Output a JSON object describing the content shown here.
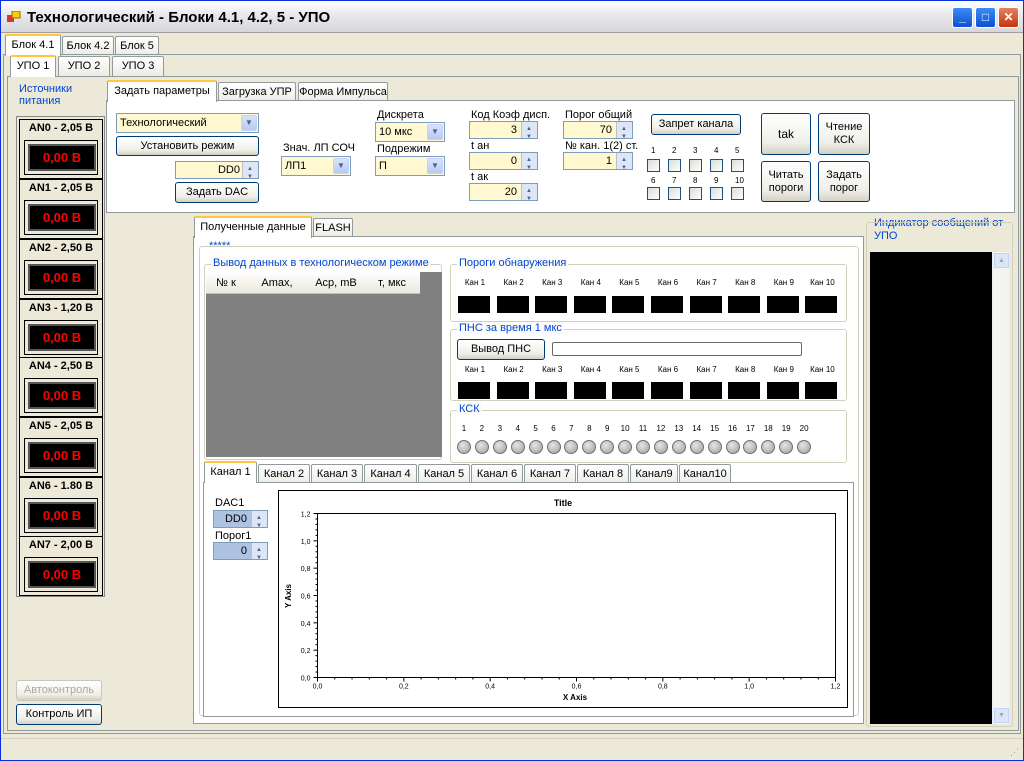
{
  "window": {
    "title": "Технологический - Блоки 4.1, 4.2, 5 - УПО"
  },
  "top_tabs": [
    "Блок 4.1",
    "Блок 4.2",
    "Блок 5"
  ],
  "upo_tabs": [
    "УПО 1",
    "УПО 2",
    "УПО 3"
  ],
  "left": {
    "title": "Источники питания",
    "sources": [
      {
        "name": "AN0 - 2,05 В",
        "value": "0,00 В"
      },
      {
        "name": "AN1 - 2,05 В",
        "value": "0,00 В"
      },
      {
        "name": "AN2 - 2,50 В",
        "value": "0,00 В"
      },
      {
        "name": "AN3 - 1,20 В",
        "value": "0,00 В"
      },
      {
        "name": "AN4 - 2,50 В",
        "value": "0,00 В"
      },
      {
        "name": "AN5 - 2,05 В",
        "value": "0,00 В"
      },
      {
        "name": "AN6 - 1.80 В",
        "value": "0,00 В"
      },
      {
        "name": "AN7 - 2,00 В",
        "value": "0,00 В"
      }
    ],
    "autocontrol": "Автоконтроль",
    "control_ip": "Контроль ИП"
  },
  "param_tabs": [
    "Задать параметры",
    "Загрузка УПР",
    "Форма Импульса"
  ],
  "params": {
    "mode": "Технологический",
    "set_mode": "Установить режим",
    "dd0": "DD0",
    "set_dac": "Задать DAC",
    "lp_label": "Знач. ЛП СОЧ",
    "lp_value": "ЛП1",
    "discrete_label": "Дискрета",
    "discrete_value": "10 мкс",
    "submode_label": "Подрежим",
    "submode_value": "П",
    "code_label": "Код Коэф дисп.",
    "code_value": "3",
    "tan_label": "t ан",
    "tan_value": "0",
    "tak_label": "t ак",
    "tak_value": "20",
    "porog_label": "Порог общий",
    "porog_value": "70",
    "kan_label": "№ кан. 1(2) ст.",
    "kan_value": "1",
    "ban": "Запрет канала",
    "checks_top": [
      "1",
      "2",
      "3",
      "4",
      "5"
    ],
    "checks_bottom": [
      "6",
      "7",
      "8",
      "9",
      "10"
    ],
    "btn_tak": "tak",
    "btn_read_ksk": "Чтение КСК",
    "btn_read_porog": "Читать пороги",
    "btn_set_porog": "Задать порог"
  },
  "data_tabs": [
    "Полученные данные",
    "FLASH"
  ],
  "stars": "*****",
  "output": {
    "title": "Вывод данных в технологическом режиме",
    "cols": [
      "№ к",
      "Amax,",
      "Acp, mB",
      "т, мкс"
    ]
  },
  "thresholds": {
    "title": "Пороги обнаружения",
    "channels": [
      "Кан 1",
      "Кан 2",
      "Кан 3",
      "Кан 4",
      "Кан 5",
      "Кан 6",
      "Кан 7",
      "Кан 8",
      "Кан 9",
      "Кан 10"
    ]
  },
  "pns": {
    "title": "ПНС за время 1 мкс",
    "button": "Вывод ПНС"
  },
  "ksk": {
    "title": "КСК",
    "nums": [
      "1",
      "2",
      "3",
      "4",
      "5",
      "6",
      "7",
      "8",
      "9",
      "10",
      "11",
      "12",
      "13",
      "14",
      "15",
      "16",
      "17",
      "18",
      "19",
      "20"
    ]
  },
  "channel_tabs": [
    "Канал 1",
    "Канал 2",
    "Канал 3",
    "Канал 4",
    "Канал 5",
    "Канал 6",
    "Канал 7",
    "Канал 8",
    "Канал9",
    "Канал10"
  ],
  "channel": {
    "dac_label": "DAC1",
    "dac_value": "DD0",
    "porog_label": "Порог1",
    "porog_value": "0"
  },
  "chart_data": {
    "type": "line",
    "title": "Title",
    "xlabel": "X Axis",
    "ylabel": "Y Axis",
    "xlim": [
      0,
      1.2
    ],
    "ylim": [
      0,
      1.2
    ],
    "xticks": [
      "0,0",
      "0,2",
      "0,4",
      "0,6",
      "0,8",
      "1,0",
      "1,2"
    ],
    "yticks": [
      "0,0",
      "0,2",
      "0,4",
      "0,6",
      "0,8",
      "1,0",
      "1,2"
    ],
    "series": []
  },
  "indicator": {
    "title": "Индикатор сообщений от УПО"
  }
}
